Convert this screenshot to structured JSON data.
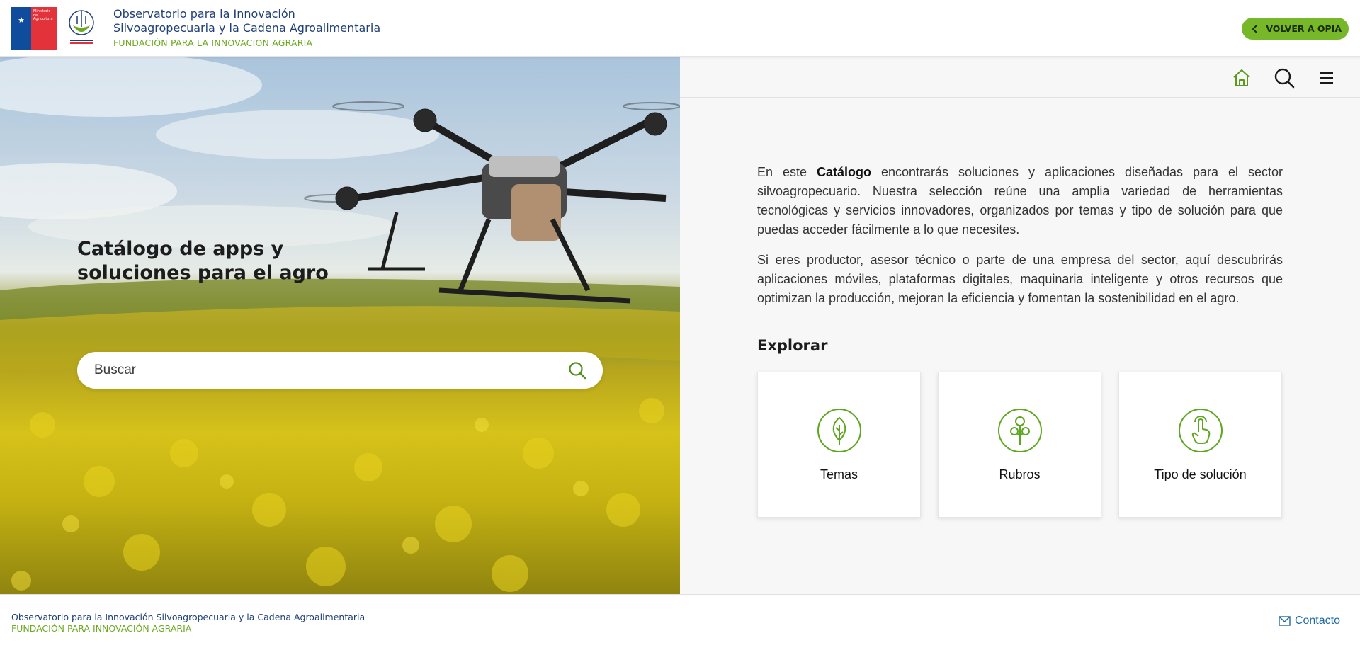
{
  "header": {
    "gov_logo_text": "Ministerio de Agricultura",
    "title_line1": "Observatorio para la Innovación",
    "title_line2": "Silvoagropecuaria y la Cadena Agroalimentaria",
    "subtitle": "FUNDACIÓN PARA LA INNOVACIÓN AGRARIA",
    "back_button": "VOLVER A OPIA"
  },
  "hero": {
    "title": "Catálogo de apps y soluciones para el agro",
    "search_placeholder": "Buscar"
  },
  "nav": {
    "icons": [
      "home-icon",
      "search-icon",
      "menu-icon"
    ]
  },
  "intro": {
    "p1_before": "En este ",
    "p1_bold": "Catálogo",
    "p1_after": " encontrarás soluciones y aplicaciones diseñadas para el sector silvoagropecuario. Nuestra selección reúne una amplia variedad de herramientas tecnológicas y servicios innovadores, organizados por temas y tipo de solución para que puedas acceder fácilmente a lo que necesites.",
    "p2": "Si eres productor, asesor técnico o parte de una empresa del sector, aquí descubrirás aplicaciones móviles, plataformas digitales, maquinaria inteligente y otros recursos que optimizan la producción, mejoran la eficiencia y fomentan la sostenibilidad en el agro."
  },
  "explore": {
    "title": "Explorar",
    "cards": [
      {
        "label": "Temas",
        "icon": "leaf-icon"
      },
      {
        "label": "Rubros",
        "icon": "sprout-icon"
      },
      {
        "label": "Tipo de solución",
        "icon": "hand-pointer-icon"
      }
    ]
  },
  "footer": {
    "line1": "Observatorio para la Innovación Silvoagropecuaria y la Cadena Agroalimentaria",
    "line2": "FUNDACIÓN PARA INNOVACIÓN AGRARIA",
    "contact": "Contacto"
  },
  "colors": {
    "accent_green": "#76b82a",
    "brand_blue": "#1f3f78",
    "link_blue": "#1f6aa5"
  }
}
